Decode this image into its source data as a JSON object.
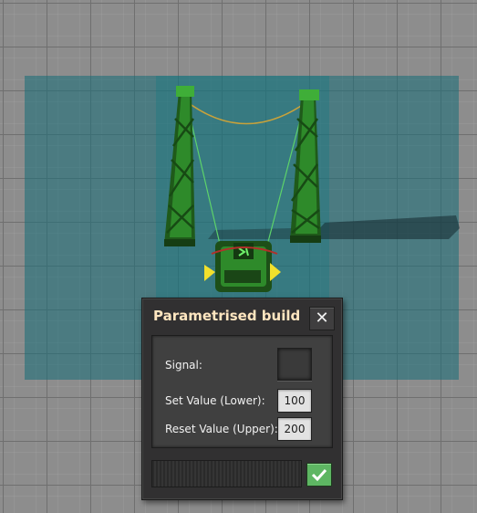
{
  "dialog": {
    "title": "Parametrised build",
    "close_icon": "close-icon",
    "confirm_icon": "checkmark-icon",
    "rows": {
      "signal_label": "Signal:",
      "set_value_label": "Set Value (Lower):",
      "set_value": "100",
      "reset_value_label": "Reset Value (Upper):",
      "reset_value": "200"
    }
  },
  "colors": {
    "title": "#ffe6c0",
    "confirm": "#5eb663",
    "overlay": "#166e78",
    "structure": "#2f8a2a"
  }
}
